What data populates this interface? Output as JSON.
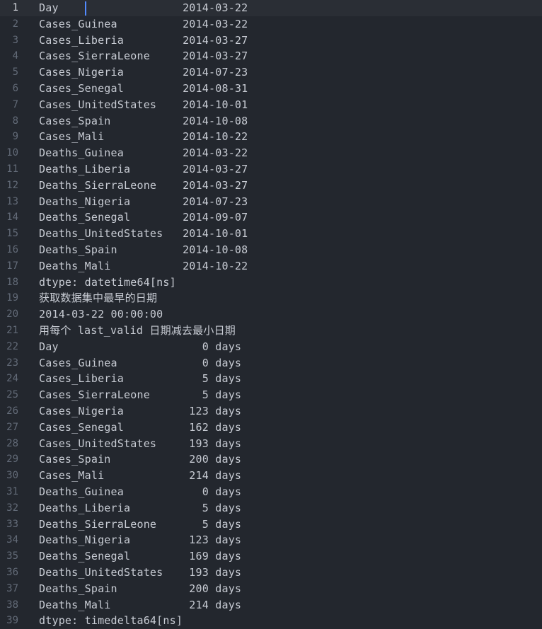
{
  "editor": {
    "current_line": 1,
    "lines": [
      {
        "num": "1",
        "text": "Day                   2014-03-22"
      },
      {
        "num": "2",
        "text": "Cases_Guinea          2014-03-22"
      },
      {
        "num": "3",
        "text": "Cases_Liberia         2014-03-27"
      },
      {
        "num": "4",
        "text": "Cases_SierraLeone     2014-03-27"
      },
      {
        "num": "5",
        "text": "Cases_Nigeria         2014-07-23"
      },
      {
        "num": "6",
        "text": "Cases_Senegal         2014-08-31"
      },
      {
        "num": "7",
        "text": "Cases_UnitedStates    2014-10-01"
      },
      {
        "num": "8",
        "text": "Cases_Spain           2014-10-08"
      },
      {
        "num": "9",
        "text": "Cases_Mali            2014-10-22"
      },
      {
        "num": "10",
        "text": "Deaths_Guinea         2014-03-22"
      },
      {
        "num": "11",
        "text": "Deaths_Liberia        2014-03-27"
      },
      {
        "num": "12",
        "text": "Deaths_SierraLeone    2014-03-27"
      },
      {
        "num": "13",
        "text": "Deaths_Nigeria        2014-07-23"
      },
      {
        "num": "14",
        "text": "Deaths_Senegal        2014-09-07"
      },
      {
        "num": "15",
        "text": "Deaths_UnitedStates   2014-10-01"
      },
      {
        "num": "16",
        "text": "Deaths_Spain          2014-10-08"
      },
      {
        "num": "17",
        "text": "Deaths_Mali           2014-10-22"
      },
      {
        "num": "18",
        "text": "dtype: datetime64[ns]"
      },
      {
        "num": "19",
        "text": "获取数据集中最早的日期"
      },
      {
        "num": "20",
        "text": "2014-03-22 00:00:00"
      },
      {
        "num": "21",
        "text": "用每个 last_valid 日期减去最小日期"
      },
      {
        "num": "22",
        "text": "Day                      0 days"
      },
      {
        "num": "23",
        "text": "Cases_Guinea             0 days"
      },
      {
        "num": "24",
        "text": "Cases_Liberia            5 days"
      },
      {
        "num": "25",
        "text": "Cases_SierraLeone        5 days"
      },
      {
        "num": "26",
        "text": "Cases_Nigeria          123 days"
      },
      {
        "num": "27",
        "text": "Cases_Senegal          162 days"
      },
      {
        "num": "28",
        "text": "Cases_UnitedStates     193 days"
      },
      {
        "num": "29",
        "text": "Cases_Spain            200 days"
      },
      {
        "num": "30",
        "text": "Cases_Mali             214 days"
      },
      {
        "num": "31",
        "text": "Deaths_Guinea            0 days"
      },
      {
        "num": "32",
        "text": "Deaths_Liberia           5 days"
      },
      {
        "num": "33",
        "text": "Deaths_SierraLeone       5 days"
      },
      {
        "num": "34",
        "text": "Deaths_Nigeria         123 days"
      },
      {
        "num": "35",
        "text": "Deaths_Senegal         169 days"
      },
      {
        "num": "36",
        "text": "Deaths_UnitedStates    193 days"
      },
      {
        "num": "37",
        "text": "Deaths_Spain           200 days"
      },
      {
        "num": "38",
        "text": "Deaths_Mali            214 days"
      },
      {
        "num": "39",
        "text": "dtype: timedelta64[ns]"
      }
    ]
  }
}
